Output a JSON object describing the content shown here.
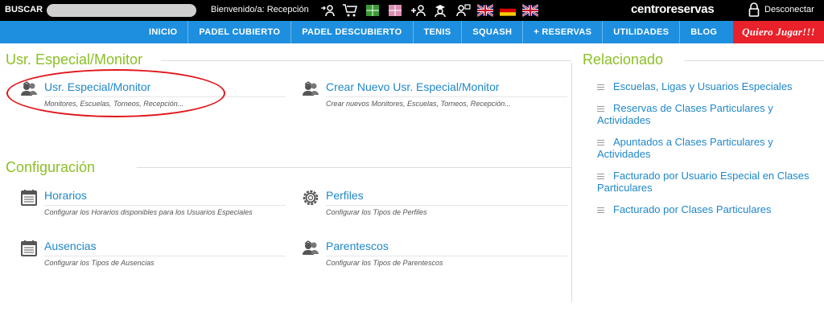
{
  "topbar": {
    "search_label": "BUSCAR",
    "search_value": "",
    "welcome": "Bienvenido/a: Recepción",
    "brand": "centroreservas",
    "logout": "Desconectar"
  },
  "nav": {
    "items": [
      "INICIO",
      "PADEL CUBIERTO",
      "PADEL DESCUBIERTO",
      "TENIS",
      "SQUASH",
      "+ RESERVAS",
      "UTILIDADES",
      "BLOG"
    ],
    "cta": "Quiero Jugar!!!"
  },
  "sections": {
    "usr": {
      "title": "Usr. Especial/Monitor",
      "items": [
        {
          "title": "Usr. Especial/Monitor",
          "desc": "Monitores, Escuelas, Torneos, Recepción..."
        },
        {
          "title": "Crear Nuevo Usr. Especial/Monitor",
          "desc": "Crear nuevos Monitores, Escuelas, Torneos, Recepción..."
        }
      ]
    },
    "config": {
      "title": "Configuración",
      "items": [
        {
          "title": "Horarios",
          "desc": "Configurar los Horarios disponibles para los Usuarios Especiales"
        },
        {
          "title": "Perfiles",
          "desc": "Configurar los Tipos de Perfiles"
        },
        {
          "title": "Ausencias",
          "desc": "Configurar los Tipos de Ausencias"
        },
        {
          "title": "Parentescos",
          "desc": "Configurar los Tipos de Parentescos"
        }
      ]
    },
    "related": {
      "title": "Relacionado",
      "items": [
        "Escuelas, Ligas y Usuarios Especiales",
        "Reservas de Clases Particulares y Actividades",
        "Apuntados a Clases Particulares y Actividades",
        "Facturado por Usuario Especial en Clases Particulares",
        "Facturado por Clases Particulares"
      ]
    }
  },
  "colors": {
    "nav_blue": "#1e8fde",
    "cta_red": "#e8212a",
    "section_green": "#8cbf26",
    "link_blue": "#1f87c9",
    "highlight_red": "#e2161c"
  }
}
